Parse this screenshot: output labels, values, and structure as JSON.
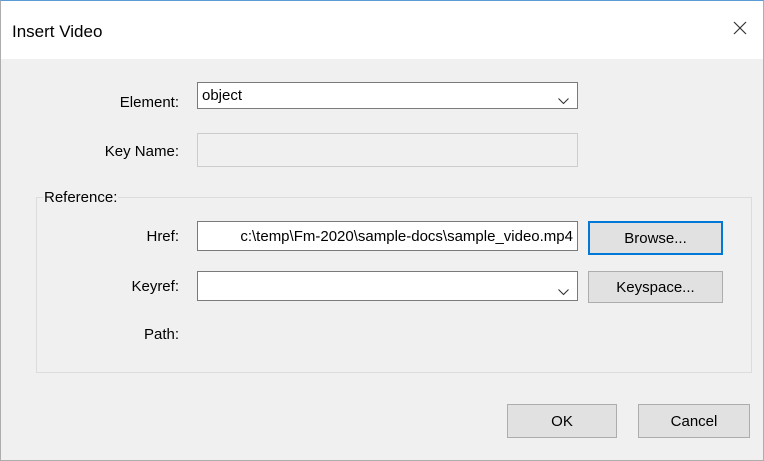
{
  "window": {
    "title": "Insert Video"
  },
  "form": {
    "element_label": "Element:",
    "element_value": "object",
    "keyname_label": "Key Name:",
    "keyname_value": "",
    "reference_group_label": "Reference:",
    "href_label": "Href:",
    "href_value": "c:\\temp\\Fm-2020\\sample-docs\\sample_video.mp4",
    "keyref_label": "Keyref:",
    "keyref_value": "",
    "path_label": "Path:",
    "path_value": ""
  },
  "buttons": {
    "browse": "Browse...",
    "keyspace": "Keyspace...",
    "ok": "OK",
    "cancel": "Cancel"
  },
  "icons": {
    "close": "close-icon",
    "dropdown": "chevron-down-icon"
  },
  "colors": {
    "dialog_bg": "#f0f0f0",
    "titlebar_bg": "#ffffff",
    "focus_border": "#0078d7",
    "button_bg": "#e1e1e1"
  }
}
